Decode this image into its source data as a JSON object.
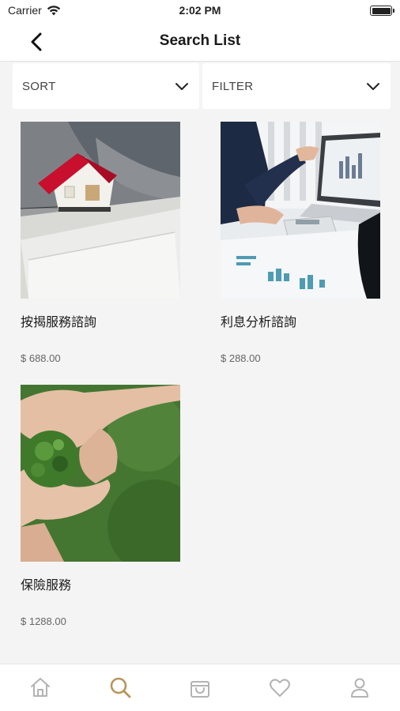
{
  "status_bar": {
    "carrier": "Carrier",
    "time": "2:02 PM"
  },
  "nav": {
    "title": "Search List",
    "back_icon": "chevron-left-icon"
  },
  "sort": {
    "label": "SORT"
  },
  "filter": {
    "label": "FILTER"
  },
  "products": [
    {
      "title": "按揭服務諮詢",
      "price": "$ 688.00",
      "image": "house-model-photo"
    },
    {
      "title": "利息分析諮詢",
      "price": "$ 288.00",
      "image": "business-analysis-photo"
    },
    {
      "title": "保險服務",
      "price": "$ 1288.00",
      "image": "hands-globe-photo"
    }
  ],
  "tab_bar": {
    "tabs": [
      "home-icon",
      "search-icon",
      "shopping-bag-icon",
      "heart-icon",
      "user-icon"
    ],
    "active": "search-icon"
  },
  "colors": {
    "accent": "#b8945a",
    "inactive_icon": "#b3b3b3",
    "background": "#f4f4f4"
  }
}
